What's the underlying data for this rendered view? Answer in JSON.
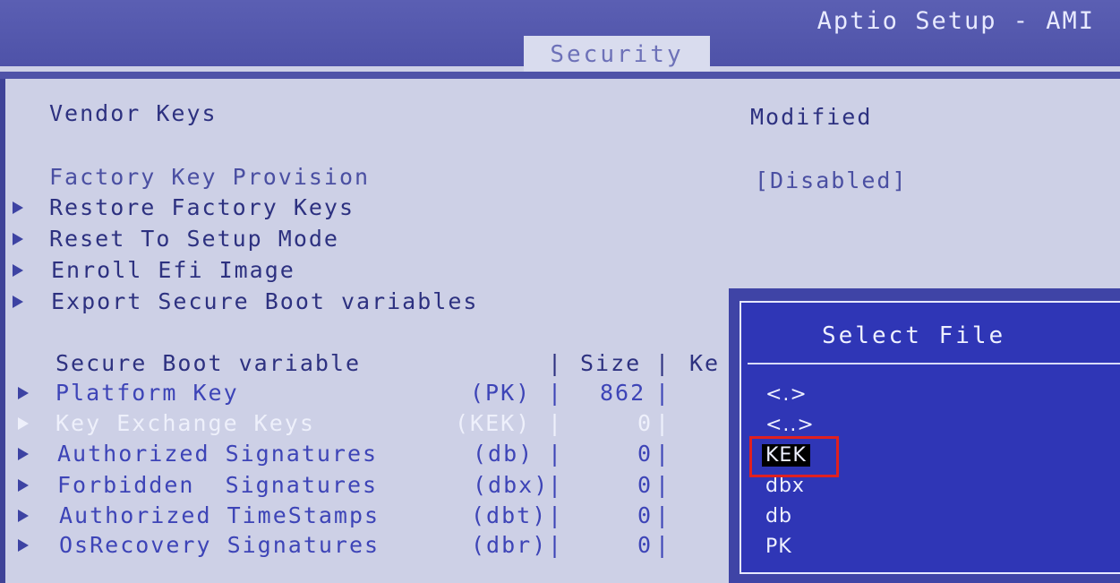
{
  "header": {
    "title": "Aptio Setup - AMI",
    "active_tab": "Security"
  },
  "vendor_keys": {
    "label": "Vendor Keys",
    "value": "Modified"
  },
  "factory_key_provision": {
    "label": "Factory Key Provision",
    "value": "[Disabled]"
  },
  "menu_items": [
    {
      "label": "Restore Factory Keys"
    },
    {
      "label": "Reset To Setup Mode"
    },
    {
      "label": "Enroll Efi Image"
    },
    {
      "label": "Export Secure Boot variables"
    }
  ],
  "table": {
    "header": {
      "variable": "Secure Boot variable",
      "size": "Size",
      "keys_partial": "Ke"
    },
    "rows": [
      {
        "name": "Platform Key",
        "short": "(PK)",
        "size": "862"
      },
      {
        "name": "Key Exchange Keys",
        "short": "(KEK)",
        "size": "0"
      },
      {
        "name": "Authorized Signatures",
        "short": "(db)",
        "size": "0"
      },
      {
        "name": "Forbidden  Signatures",
        "short": "(dbx)",
        "size": "0"
      },
      {
        "name": "Authorized TimeStamps",
        "short": "(dbt)",
        "size": "0"
      },
      {
        "name": "OsRecovery Signatures",
        "short": "(dbr)",
        "size": "0"
      }
    ]
  },
  "select_file": {
    "title": "Select File",
    "items": [
      "<.>",
      "<..>",
      "KEK",
      "dbx",
      "db",
      "PK"
    ],
    "selected": "KEK"
  }
}
